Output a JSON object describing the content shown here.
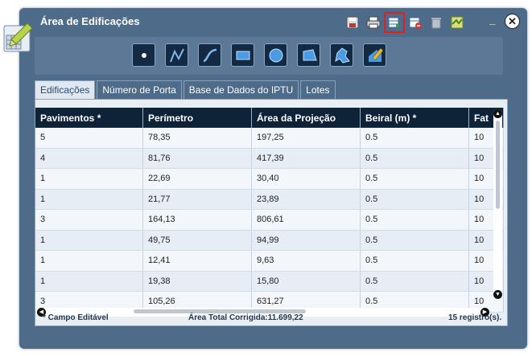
{
  "window": {
    "title": "Área de Edificações"
  },
  "toolbar": {
    "icons": [
      {
        "name": "save-icon",
        "color": "#c0392b"
      },
      {
        "name": "print-icon",
        "color": "#333333"
      },
      {
        "name": "export-table-icon",
        "color": "#2f6fb3",
        "selected": true
      },
      {
        "name": "remove-table-icon",
        "color": "#c0392b"
      },
      {
        "name": "trash-icon",
        "color": "#9aa6b2"
      },
      {
        "name": "map-icon",
        "color": "#6aa84f"
      }
    ]
  },
  "draw_tools": [
    "point",
    "polyline",
    "curve",
    "rectangle",
    "circle",
    "polygon",
    "freehand",
    "edit"
  ],
  "tabs": [
    {
      "label": "Edificações",
      "active": true
    },
    {
      "label": "Número de Porta",
      "active": false
    },
    {
      "label": "Base de Dados do IPTU",
      "active": false
    },
    {
      "label": "Lotes",
      "active": false
    }
  ],
  "table": {
    "columns": [
      "Pavimentos *",
      "Perímetro",
      "Área da Projeção",
      "Beiral (m) *",
      "Fat"
    ],
    "rows": [
      [
        "5",
        "78,35",
        "197,25",
        "0.5",
        "10"
      ],
      [
        "4",
        "81,76",
        "417,39",
        "0.5",
        "10"
      ],
      [
        "1",
        "22,69",
        "30,40",
        "0.5",
        "10"
      ],
      [
        "1",
        "21,77",
        "23,89",
        "0.5",
        "10"
      ],
      [
        "3",
        "164,13",
        "806,61",
        "0.5",
        "10"
      ],
      [
        "1",
        "49,75",
        "94,99",
        "0.5",
        "10"
      ],
      [
        "1",
        "12,41",
        "9,63",
        "0.5",
        "10"
      ],
      [
        "1",
        "19,38",
        "15,80",
        "0.5",
        "10"
      ],
      [
        "3",
        "105,26",
        "631,27",
        "0.5",
        "10"
      ]
    ]
  },
  "footer": {
    "editable_note": "* Campo Editável",
    "total_area": "Área Total Corrigida:11.699,22",
    "records": "15 registro(s)."
  }
}
